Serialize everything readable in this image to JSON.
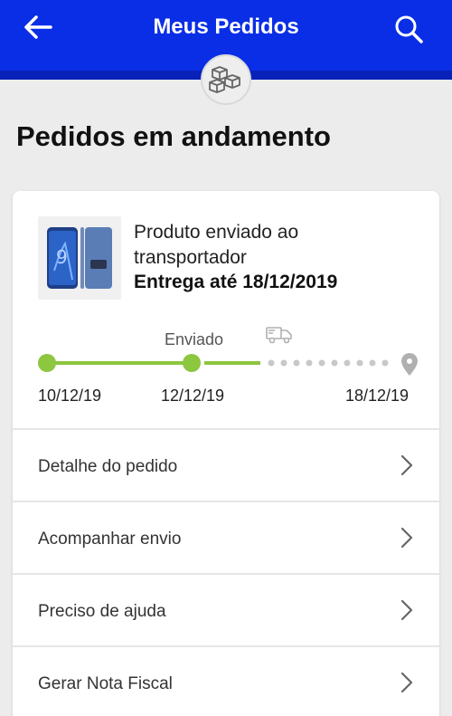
{
  "header": {
    "title": "Meus Pedidos",
    "background_color": "#0a2ee6",
    "back_icon": "arrow-left-icon",
    "search_icon": "search-icon",
    "badge_icon": "boxes-icon"
  },
  "section": {
    "title": "Pedidos em andamento"
  },
  "order": {
    "product_image": "samsung-phone-image",
    "status": "Produto enviado ao transportador",
    "delivery": "Entrega até 18/12/2019"
  },
  "tracker": {
    "current_step_label": "Enviado",
    "truck_icon": "truck-icon",
    "destination_icon": "location-pin-icon",
    "dates": [
      "10/12/19",
      "12/12/19",
      "18/12/19"
    ],
    "progress_color": "#8dc63f",
    "pending_color": "#c8c8c8"
  },
  "menu": [
    {
      "label": "Detalhe do pedido"
    },
    {
      "label": "Acompanhar envio"
    },
    {
      "label": "Preciso de ajuda"
    },
    {
      "label": "Gerar Nota Fiscal"
    }
  ]
}
